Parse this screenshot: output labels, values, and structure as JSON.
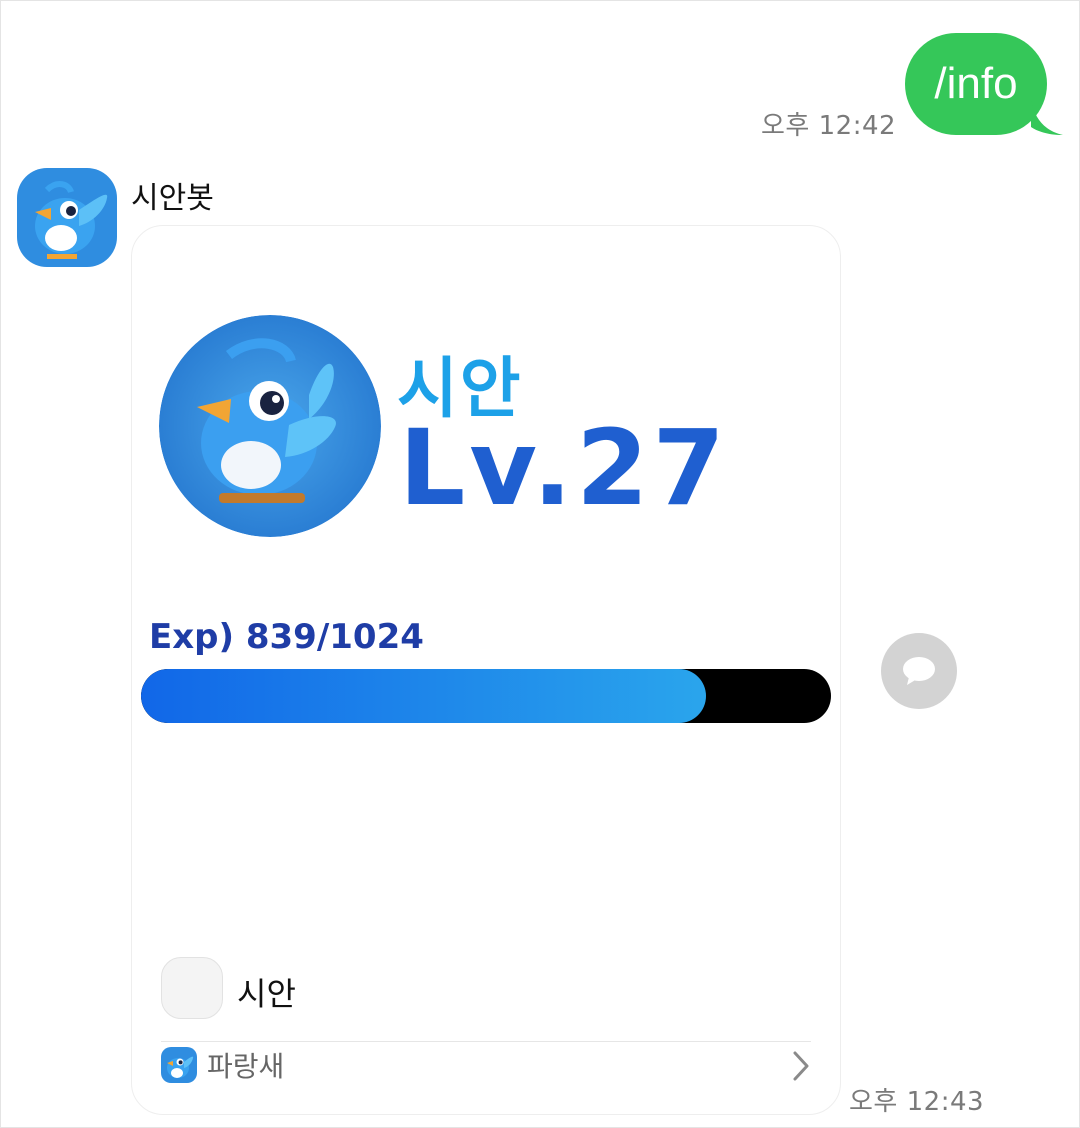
{
  "outgoing": {
    "text": "/info",
    "time": "오후 12:42",
    "color": "#35c759"
  },
  "incoming": {
    "sender_name": "시안봇",
    "time": "오후 12:43",
    "card": {
      "profile_name": "시안",
      "level_text": "Lv.27",
      "exp_text": "Exp) 839/1024",
      "exp_current": 839,
      "exp_max": 1024,
      "footer_name": "시안",
      "footer_app": "파랑새"
    }
  },
  "icons": {
    "sender_avatar": "blue-bird-avatar-icon",
    "profile_avatar": "blue-bird-profile-icon",
    "footer_app_icon": "blue-bird-app-icon",
    "chevron": "chevron-right-icon",
    "side_action": "speech-bubble-icon"
  },
  "colors": {
    "level": "#1f5fd0",
    "profile_name": "#1da1e8",
    "exp_label": "#1f3da6",
    "bar_fill_start": "#1167e8",
    "bar_fill_end": "#2aa5ec",
    "bar_track": "#000000"
  }
}
